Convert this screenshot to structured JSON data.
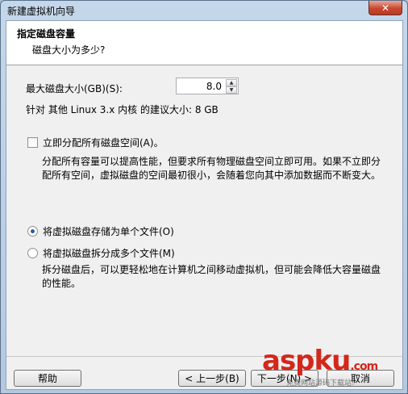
{
  "window": {
    "title": "新建虚拟机向导",
    "close_glyph": "✕"
  },
  "header": {
    "title": "指定磁盘容量",
    "subtitle": "磁盘大小为多少?"
  },
  "disk_size": {
    "label": "最大磁盘大小(GB)(S):",
    "value": "8.0",
    "up_glyph": "▲",
    "down_glyph": "▼"
  },
  "recommendation": "针对 其他 Linux 3.x 内核 的建议大小: 8 GB",
  "allocate": {
    "label": "立即分配所有磁盘空间(A)。",
    "checked": false,
    "description": "分配所有容量可以提高性能，但要求所有物理磁盘空间立即可用。如果不立即分配所有空间，虚拟磁盘的空间最初很小，会随着您向其中添加数据而不断变大。"
  },
  "storage": {
    "single_label": "将虚拟磁盘存储为单个文件(O)",
    "multi_label": "将虚拟磁盘拆分成多个文件(M)",
    "selected": "single",
    "multi_description": "拆分磁盘后，可以更轻松地在计算机之间移动虚拟机，但可能会降低大容量磁盘的性能。"
  },
  "buttons": {
    "help": "帮助",
    "back": "< 上一步(B)",
    "next": "下一步(N) >",
    "finish": "取消"
  },
  "watermark": {
    "main": "aspku",
    "domain": ".com",
    "sub": "免费网站源码下载站!"
  },
  "colors": {
    "accent_radio": "#2a5ea6",
    "watermark_red": "#d4271b"
  }
}
